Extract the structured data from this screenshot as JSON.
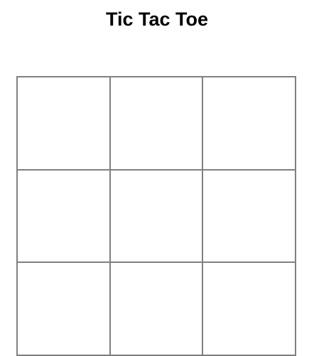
{
  "title": "Tic Tac Toe",
  "board": {
    "cells": [
      "",
      "",
      "",
      "",
      "",
      "",
      "",
      "",
      ""
    ],
    "grid_color": "#808080"
  }
}
